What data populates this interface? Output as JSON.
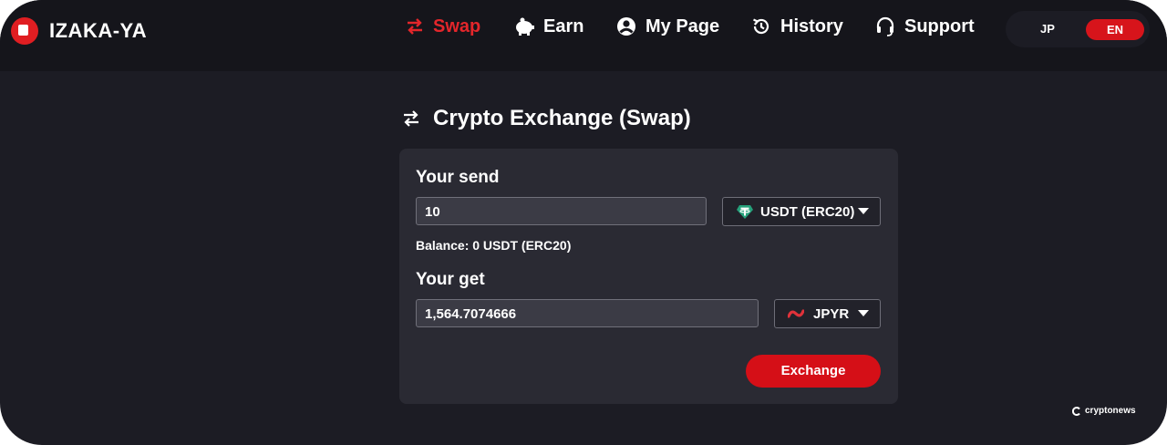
{
  "brand": {
    "name": "IZAKA-YA",
    "logo_icon": "izakaya-logo-icon"
  },
  "nav": [
    {
      "label": "Swap",
      "icon": "swap-arrows-icon",
      "active": true
    },
    {
      "label": "Earn",
      "icon": "piggy-bank-icon",
      "active": false
    },
    {
      "label": "My Page",
      "icon": "user-circle-icon",
      "active": false
    },
    {
      "label": "History",
      "icon": "history-icon",
      "active": false
    },
    {
      "label": "Support",
      "icon": "headset-icon",
      "active": false
    }
  ],
  "language": {
    "options": [
      "JP",
      "EN"
    ],
    "selected": "EN"
  },
  "page": {
    "title": "Crypto Exchange (Swap)",
    "title_icon": "swap-arrows-icon"
  },
  "send": {
    "label": "Your send",
    "amount": "10",
    "token": "USDT (ERC20)",
    "token_icon": "tether-icon",
    "balance": "Balance: 0 USDT (ERC20)"
  },
  "get": {
    "label": "Your get",
    "amount": "1,564.7074666",
    "token": "JPYR",
    "token_icon": "jpyr-icon"
  },
  "exchange_button": "Exchange",
  "watermark": "cryptonews",
  "colors": {
    "accent": "#e3262b",
    "button": "#d50f17",
    "background": "#1c1c24",
    "card": "#2a2a33",
    "navbar": "#15151b"
  }
}
